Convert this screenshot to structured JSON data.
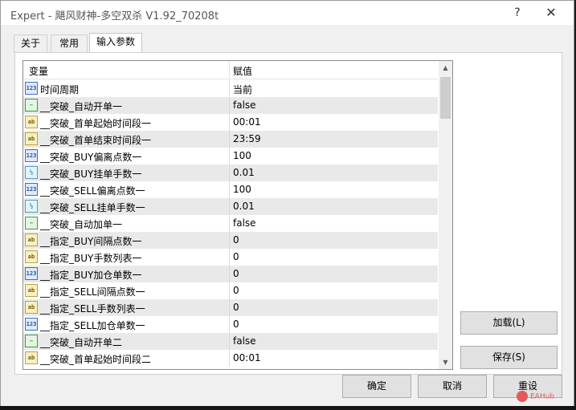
{
  "window": {
    "title": "Expert - 飓风财神-多空双杀 V1.92_70208t",
    "help_glyph": "?",
    "close_glyph": "✕"
  },
  "tabs": [
    {
      "label": "关于",
      "active": false
    },
    {
      "label": "常用",
      "active": false
    },
    {
      "label": "输入参数",
      "active": true
    }
  ],
  "table": {
    "header_variable": "变量",
    "header_value": "赋值",
    "rows": [
      {
        "icon": "int-type-icon",
        "badge": "123",
        "name": "时间周期",
        "value": "当前"
      },
      {
        "icon": "bool-type-icon",
        "badge": "~",
        "name": "__突破_自动开单一",
        "value": "false"
      },
      {
        "icon": "string-type-icon",
        "badge": "ab",
        "name": "__突破_首单起始时间段一",
        "value": "00:01"
      },
      {
        "icon": "string-type-icon",
        "badge": "ab",
        "name": "__突破_首单结束时间段一",
        "value": "23:59"
      },
      {
        "icon": "int-type-icon",
        "badge": "123",
        "name": "__突破_BUY偏离点数一",
        "value": "100"
      },
      {
        "icon": "double-type-icon",
        "badge": "½",
        "name": "__突破_BUY挂单手数一",
        "value": "0.01"
      },
      {
        "icon": "int-type-icon",
        "badge": "123",
        "name": "__突破_SELL偏离点数一",
        "value": "100"
      },
      {
        "icon": "double-type-icon",
        "badge": "½",
        "name": "__突破_SELL挂单手数一",
        "value": "0.01"
      },
      {
        "icon": "bool-type-icon",
        "badge": "~",
        "name": "__突破_自动加单一",
        "value": "false"
      },
      {
        "icon": "string-type-icon",
        "badge": "ab",
        "name": "__指定_BUY间隔点数一",
        "value": "0"
      },
      {
        "icon": "string-type-icon",
        "badge": "ab",
        "name": "__指定_BUY手数列表一",
        "value": "0"
      },
      {
        "icon": "int-type-icon",
        "badge": "123",
        "name": "__指定_BUY加仓单数一",
        "value": "0"
      },
      {
        "icon": "string-type-icon",
        "badge": "ab",
        "name": "__指定_SELL间隔点数一",
        "value": "0"
      },
      {
        "icon": "string-type-icon",
        "badge": "ab",
        "name": "__指定_SELL手数列表一",
        "value": "0"
      },
      {
        "icon": "int-type-icon",
        "badge": "123",
        "name": "__指定_SELL加仓单数一",
        "value": "0"
      },
      {
        "icon": "bool-type-icon",
        "badge": "~",
        "name": "__突破_自动开单二",
        "value": "false"
      },
      {
        "icon": "string-type-icon",
        "badge": "ab",
        "name": "__突破_首单起始时间段二",
        "value": "00:01"
      }
    ]
  },
  "buttons": {
    "load": "加载(L)",
    "save": "保存(S)",
    "ok": "确定",
    "cancel": "取消",
    "reset": "重设"
  },
  "scrollbar": {
    "up_glyph": "▲",
    "down_glyph": "▼"
  },
  "watermark": {
    "text": "EAHub"
  }
}
